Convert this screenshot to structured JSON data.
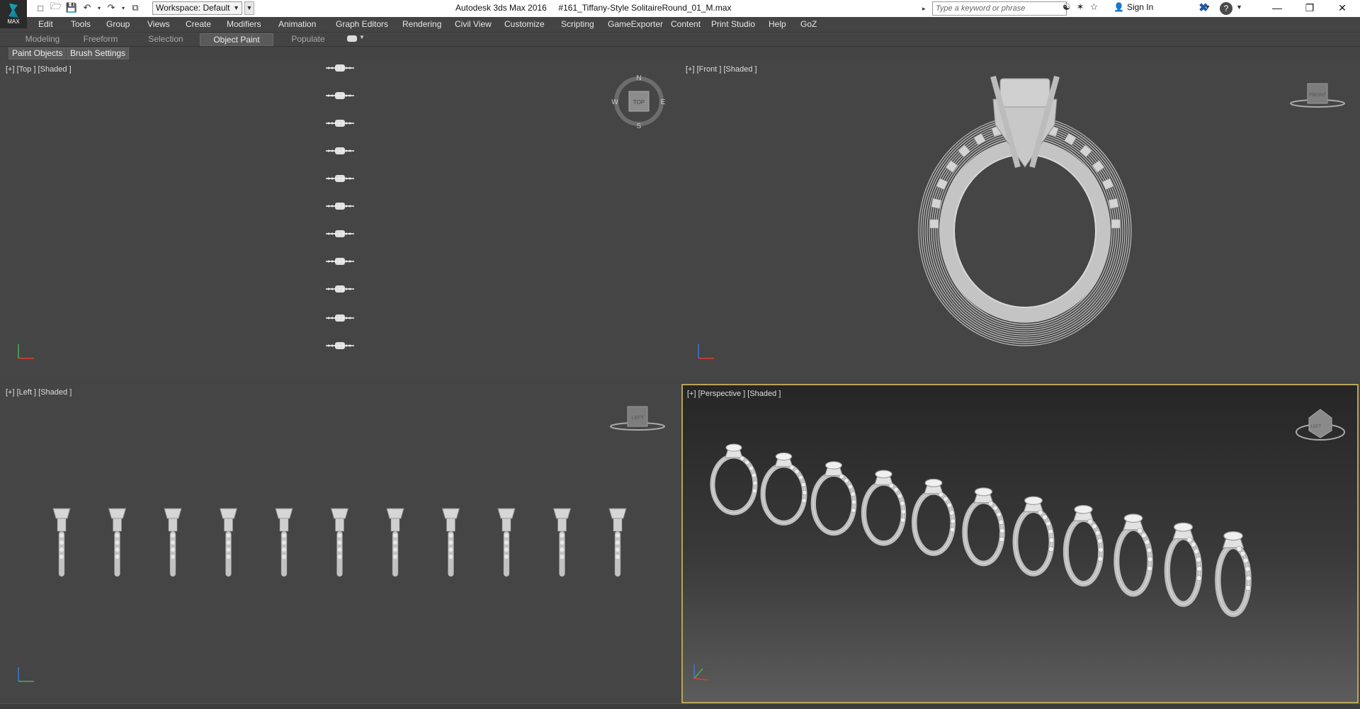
{
  "app": {
    "title": "Autodesk 3ds Max 2016",
    "file": "#161_Tiffany-Style SolitaireRound_01_M.max",
    "logo_text": "MAX",
    "workspace": "Workspace: Default",
    "search_placeholder": "Type a keyword or phrase",
    "sign_in": "Sign In"
  },
  "menu": [
    "Edit",
    "Tools",
    "Group",
    "Views",
    "Create",
    "Modifiers",
    "Animation",
    "Graph Editors",
    "Rendering",
    "Civil View",
    "Customize",
    "Scripting",
    "GameExporter",
    "Content",
    "Print Studio",
    "Help",
    "GoZ"
  ],
  "ribbon": {
    "tabs": [
      "Modeling",
      "Freeform",
      "Selection",
      "Object Paint",
      "Populate"
    ],
    "active_tab": "Object Paint",
    "subtabs": [
      "Paint Objects",
      "Brush Settings"
    ]
  },
  "viewports": {
    "top": {
      "label": "[+] [Top ] [Shaded ]",
      "cube": "TOP",
      "compass": [
        "N",
        "S",
        "W",
        "E"
      ]
    },
    "front": {
      "label": "[+] [Front ] [Shaded ]",
      "cube": "FRONT"
    },
    "left": {
      "label": "[+] [Left ] [Shaded ]",
      "cube": "LEFT"
    },
    "perspective": {
      "label": "[+] [Perspective ] [Shaded ]",
      "cube": "LEFT"
    }
  },
  "rings": {
    "count": 11
  },
  "colors": {
    "accent": "#b8a35a",
    "viewport_bg": "#454545",
    "model": "#c8c8c8"
  }
}
